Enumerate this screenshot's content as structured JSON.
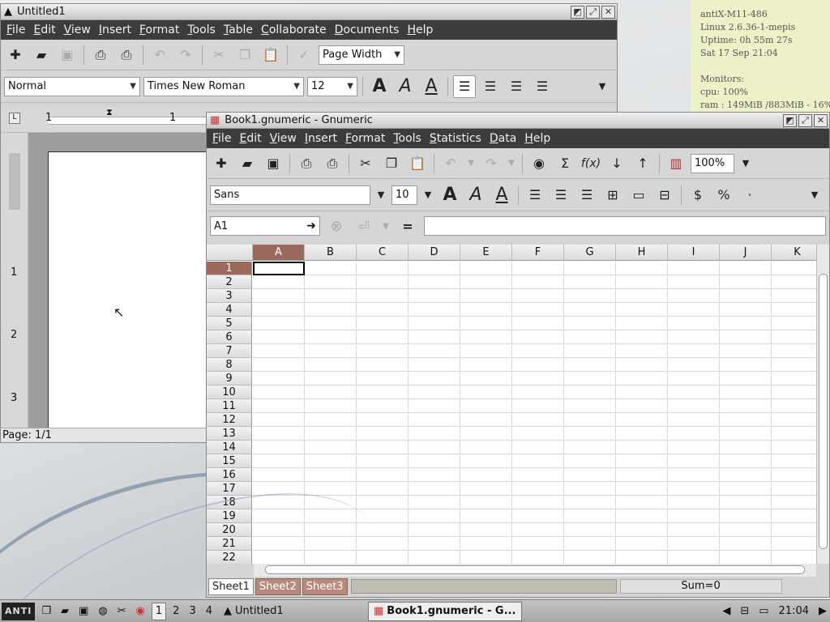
{
  "conky": {
    "lines": [
      "antiX-M11-486",
      "Linux 2.6.36-1-mepis",
      "Uptime: 0h 55m 27s",
      "Sat 17 Sep 21:04",
      "",
      "Monitors:",
      "cpu: 100%",
      "ram : 149MiB /883MiB - 16%"
    ]
  },
  "writer": {
    "title": "Untitled1",
    "menu": [
      "File",
      "Edit",
      "View",
      "Insert",
      "Format",
      "Tools",
      "Table",
      "Collaborate",
      "Documents",
      "Help"
    ],
    "zoom_label": "Page Width",
    "style_value": "Normal",
    "font_value": "Times New Roman",
    "size_value": "12",
    "vruler_marks": [
      "1",
      "2",
      "3"
    ],
    "ruler_marks": [
      "1",
      "1"
    ],
    "status_page": "Page: 1/1"
  },
  "gnumeric": {
    "title": "Book1.gnumeric - Gnumeric",
    "menu": [
      "File",
      "Edit",
      "View",
      "Insert",
      "Format",
      "Tools",
      "Statistics",
      "Data",
      "Help"
    ],
    "zoom_value": "100%",
    "font_value": "Sans",
    "size_value": "10",
    "cell_ref": "A1",
    "formula_value": "",
    "equals_sign": "=",
    "columns": [
      "A",
      "B",
      "C",
      "D",
      "E",
      "F",
      "G",
      "H",
      "I",
      "J",
      "K"
    ],
    "rows": [
      "1",
      "2",
      "3",
      "4",
      "5",
      "6",
      "7",
      "8",
      "9",
      "10",
      "11",
      "12",
      "13",
      "14",
      "15",
      "16",
      "17",
      "18",
      "19",
      "20",
      "21",
      "22"
    ],
    "sheets": [
      "Sheet1",
      "Sheet2",
      "Sheet3"
    ],
    "sum": "Sum=0"
  },
  "taskbar": {
    "start_label": "ANTI",
    "workspaces": [
      "1",
      "2",
      "3",
      "4"
    ],
    "tasks": [
      "Untitled1",
      "Book1.gnumeric - G..."
    ],
    "clock": "21:04"
  }
}
